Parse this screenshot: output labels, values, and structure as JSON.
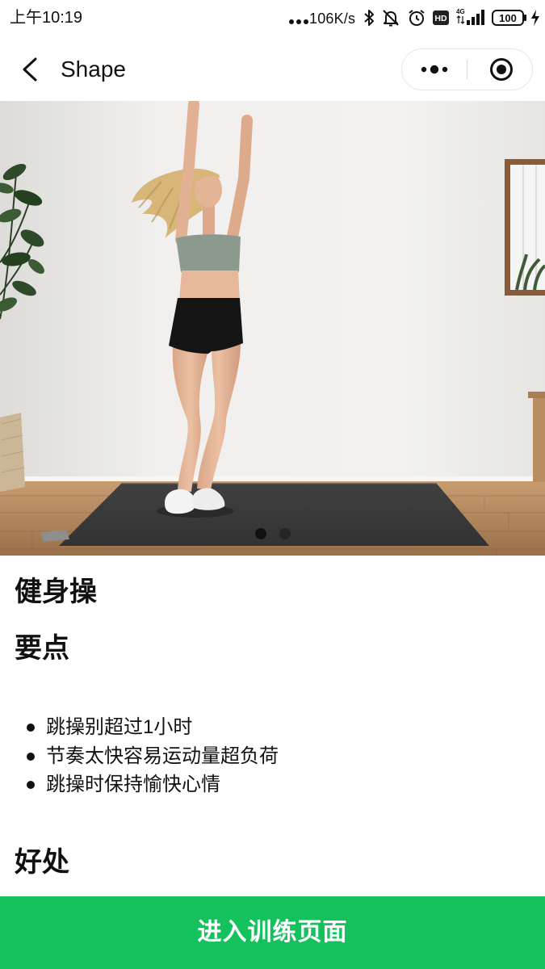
{
  "status_bar": {
    "time": "上午10:19",
    "network_speed": "106K/s",
    "hd_label": "HD",
    "network_type": "4G",
    "battery": "100",
    "icons": [
      "more-notifications-icon",
      "bluetooth-icon",
      "bell-off-icon",
      "alarm-icon",
      "hd-icon",
      "signal-icon",
      "battery-icon",
      "charging-icon"
    ]
  },
  "nav_bar": {
    "title": "Shape",
    "back_icon": "chevron-left-icon",
    "menu_icon": "more-dots-icon",
    "close_icon": "target-circle-icon"
  },
  "carousel": {
    "slide_count": 2,
    "active_index": 0
  },
  "content": {
    "title": "健身操",
    "key_points": {
      "heading": "要点",
      "items": [
        "跳操别超过1小时",
        "节奏太快容易运动量超负荷",
        "跳操时保持愉快心情"
      ]
    },
    "benefits": {
      "heading": "好处"
    }
  },
  "cta": {
    "label": "进入训练页面"
  },
  "colors": {
    "accent": "#15C15D",
    "text": "#111111",
    "background": "#FFFFFF"
  }
}
